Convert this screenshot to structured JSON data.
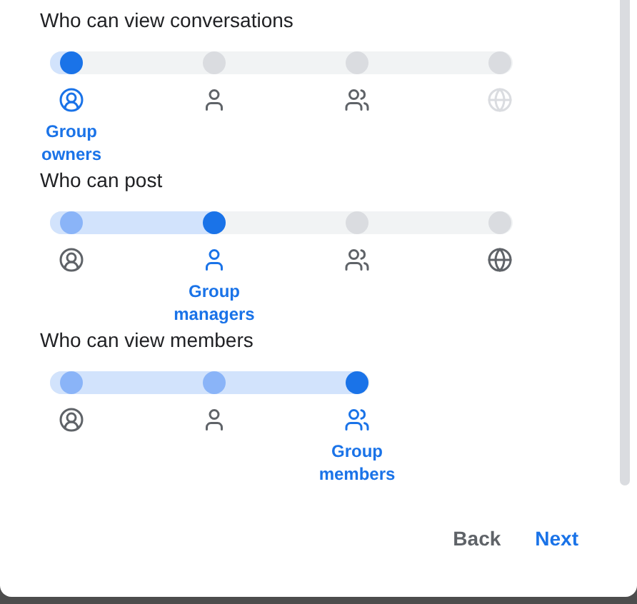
{
  "settings": [
    {
      "title": "Who can view conversations",
      "options": [
        {
          "selected": true,
          "disabled": false,
          "label": "Group owners"
        },
        {
          "selected": false,
          "disabled": false
        },
        {
          "selected": false,
          "disabled": false
        },
        {
          "selected": false,
          "disabled": true
        }
      ]
    },
    {
      "title": "Who can post",
      "options": [
        {
          "selected": false,
          "disabled": false
        },
        {
          "selected": true,
          "disabled": false,
          "label": "Group managers"
        },
        {
          "selected": false,
          "disabled": false
        },
        {
          "selected": false,
          "disabled": false
        }
      ]
    },
    {
      "title": "Who can view members",
      "options": [
        {
          "selected": false,
          "disabled": false
        },
        {
          "selected": false,
          "disabled": false
        },
        {
          "selected": true,
          "disabled": false,
          "label": "Group members"
        }
      ]
    }
  ],
  "buttons": [
    {
      "label": "Back",
      "kind": "secondary"
    },
    {
      "label": "Next",
      "kind": "primary"
    }
  ]
}
